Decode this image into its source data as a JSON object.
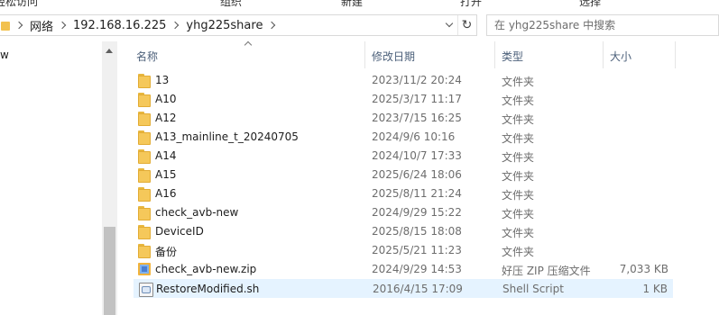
{
  "ribbon": {
    "items": [
      "轻松访问",
      "组织",
      "新建",
      "打开",
      "选择"
    ]
  },
  "address": {
    "breadcrumbs": [
      "网络",
      "192.168.16.225",
      "yhg225share"
    ],
    "refresh_glyph": "↻"
  },
  "search": {
    "placeholder": "在 yhg225share 中搜索"
  },
  "nav": {
    "partial_label": "w"
  },
  "columns": {
    "name": "名称",
    "date": "修改日期",
    "type": "类型",
    "size": "大小"
  },
  "files": [
    {
      "name": "13",
      "date": "2023/11/2 20:24",
      "type": "文件夹",
      "size": "",
      "icon": "folder-icon"
    },
    {
      "name": "A10",
      "date": "2025/3/17 11:17",
      "type": "文件夹",
      "size": "",
      "icon": "folder-icon"
    },
    {
      "name": "A12",
      "date": "2023/7/15 16:25",
      "type": "文件夹",
      "size": "",
      "icon": "folder-icon"
    },
    {
      "name": "A13_mainline_t_20240705",
      "date": "2024/9/6 10:16",
      "type": "文件夹",
      "size": "",
      "icon": "folder-icon"
    },
    {
      "name": "A14",
      "date": "2024/10/7 17:33",
      "type": "文件夹",
      "size": "",
      "icon": "folder-icon"
    },
    {
      "name": "A15",
      "date": "2025/6/24 18:06",
      "type": "文件夹",
      "size": "",
      "icon": "folder-icon"
    },
    {
      "name": "A16",
      "date": "2025/8/11 21:24",
      "type": "文件夹",
      "size": "",
      "icon": "folder-icon"
    },
    {
      "name": "check_avb-new",
      "date": "2024/9/29 15:22",
      "type": "文件夹",
      "size": "",
      "icon": "folder-icon"
    },
    {
      "name": "DeviceID",
      "date": "2025/8/15 18:08",
      "type": "文件夹",
      "size": "",
      "icon": "folder-icon"
    },
    {
      "name": "备份",
      "date": "2025/5/21 11:23",
      "type": "文件夹",
      "size": "",
      "icon": "folder-icon"
    },
    {
      "name": "check_avb-new.zip",
      "date": "2024/9/29 14:53",
      "type": "好压 ZIP 压缩文件",
      "size": "7,033 KB",
      "icon": "zip-archive-icon"
    },
    {
      "name": "RestoreModified.sh",
      "date": "2016/4/15 17:09",
      "type": "Shell Script",
      "size": "1 KB",
      "icon": "shell-script-icon",
      "selected": true
    }
  ],
  "colors": {
    "selection": "#e5f3ff",
    "folder": "#f5c85a",
    "header_text": "#4c607a",
    "meta_text": "#6d6d6d"
  }
}
